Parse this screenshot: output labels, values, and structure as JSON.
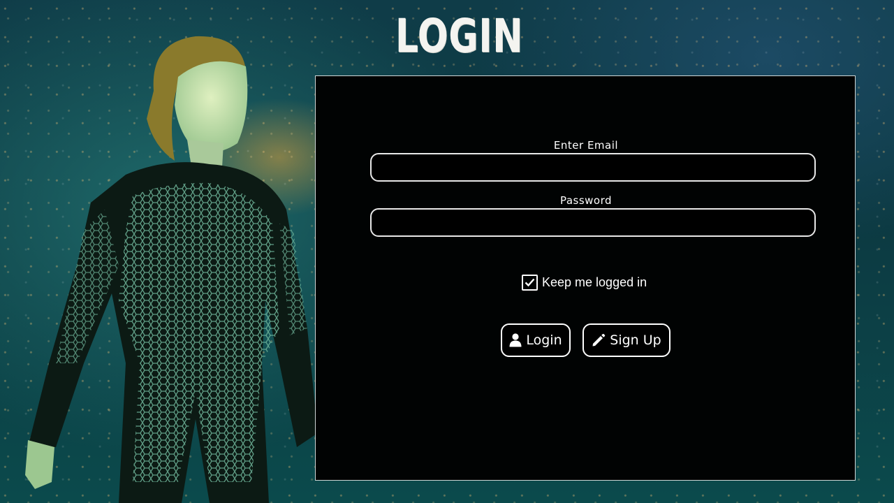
{
  "header": {
    "title": "LOGIN"
  },
  "form": {
    "email": {
      "label": "Enter Email",
      "value": "",
      "placeholder": ""
    },
    "password": {
      "label": "Password",
      "value": "",
      "placeholder": ""
    },
    "remember": {
      "label": "Keep me logged in",
      "checked": true
    },
    "buttons": {
      "login": {
        "label": "Login",
        "icon": "user-icon"
      },
      "signup": {
        "label": "Sign Up",
        "icon": "pencil-icon"
      }
    }
  },
  "colors": {
    "panel_bg": "#010303",
    "panel_border": "#cfd6d6",
    "accent": "#ffffff",
    "background": "#0f3c48"
  }
}
